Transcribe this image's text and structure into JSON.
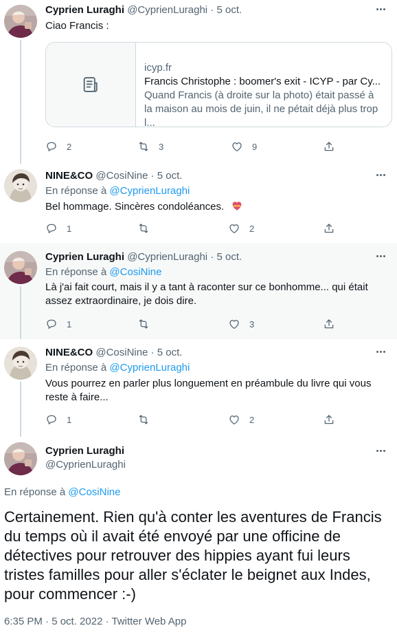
{
  "tweets": [
    {
      "name": "Cyprien Luraghi",
      "handle": "@CyprienLuraghi",
      "sep": "·",
      "date": "5 oct.",
      "text": "Ciao Francis :",
      "card": {
        "domain": "icyp.fr",
        "title": "Francis Christophe : boomer's exit - ICYP - par Cy...",
        "description": "Quand Francis (à droite sur la photo) était passé à la maison au mois de juin, il ne pétait déjà plus trop l..."
      },
      "replies": "2",
      "retweets": "3",
      "likes": "9"
    },
    {
      "name": "NINE&CO",
      "handle": "@CosiNine",
      "sep": "·",
      "date": "5 oct.",
      "reply_prefix": "En réponse à",
      "reply_to": "@CyprienLuraghi",
      "text": "Bel hommage. Sincères condoléances.",
      "emoji": "heart-icon",
      "replies": "1",
      "retweets": "",
      "likes": "2"
    },
    {
      "name": "Cyprien Luraghi",
      "handle": "@CyprienLuraghi",
      "sep": "·",
      "date": "5 oct.",
      "reply_prefix": "En réponse à",
      "reply_to": "@CosiNine",
      "text": "Là j'ai fait court, mais il y a tant à raconter sur ce bonhomme... qui était assez extraordinaire, je dois dire.",
      "replies": "1",
      "retweets": "",
      "likes": "3"
    },
    {
      "name": "NINE&CO",
      "handle": "@CosiNine",
      "sep": "·",
      "date": "5 oct.",
      "reply_prefix": "En réponse à",
      "reply_to": "@CyprienLuraghi",
      "text": "Vous pourrez en parler plus longuement en préambule du livre qui vous reste à faire...",
      "replies": "1",
      "retweets": "",
      "likes": "2"
    }
  ],
  "main_tweet": {
    "name": "Cyprien Luraghi",
    "handle": "@CyprienLuraghi",
    "reply_prefix": "En réponse à",
    "reply_to": "@CosiNine",
    "text": "Certainement. Rien qu'à conter les aventures de Francis du temps où il avait été envoyé par une officine de détectives pour retrouver des hippies ayant fui leurs tristes familles pour aller s'éclater le beignet aux Indes, pour commencer :-)",
    "meta": "6:35 PM · 5 oct. 2022 · Twitter Web App"
  },
  "colors": {
    "accent": "#1d9bf0",
    "secondary_text": "#536471",
    "highlight_bg": "#f7f9f9",
    "border": "#cfd9de"
  }
}
